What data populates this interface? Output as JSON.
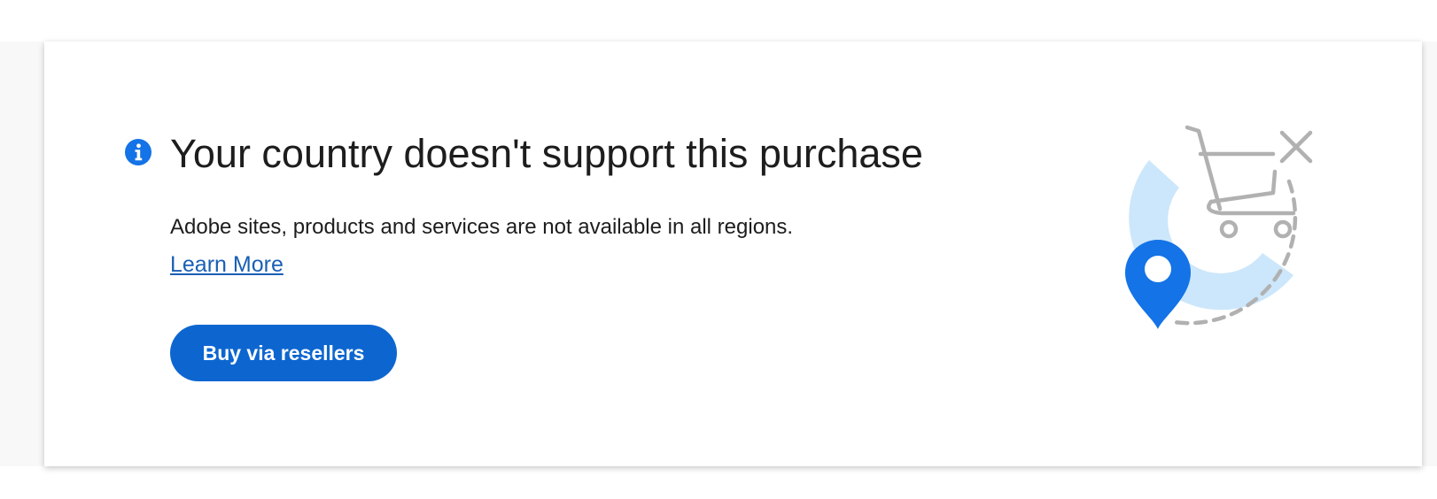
{
  "notice": {
    "title": "Your country doesn't support this purchase",
    "description": "Adobe sites, products and services are not available in all regions.",
    "learn_more_label": "Learn More",
    "buy_button_label": "Buy via resellers"
  },
  "icons": {
    "info": "info-icon",
    "illustration": "cart-unavailable-location-illustration"
  },
  "colors": {
    "accent": "#0d66d0",
    "link": "#1a5fb4",
    "illustration_light_blue": "#cce7fb",
    "illustration_gray": "#b1b1b1",
    "pin_blue": "#1473e6"
  }
}
